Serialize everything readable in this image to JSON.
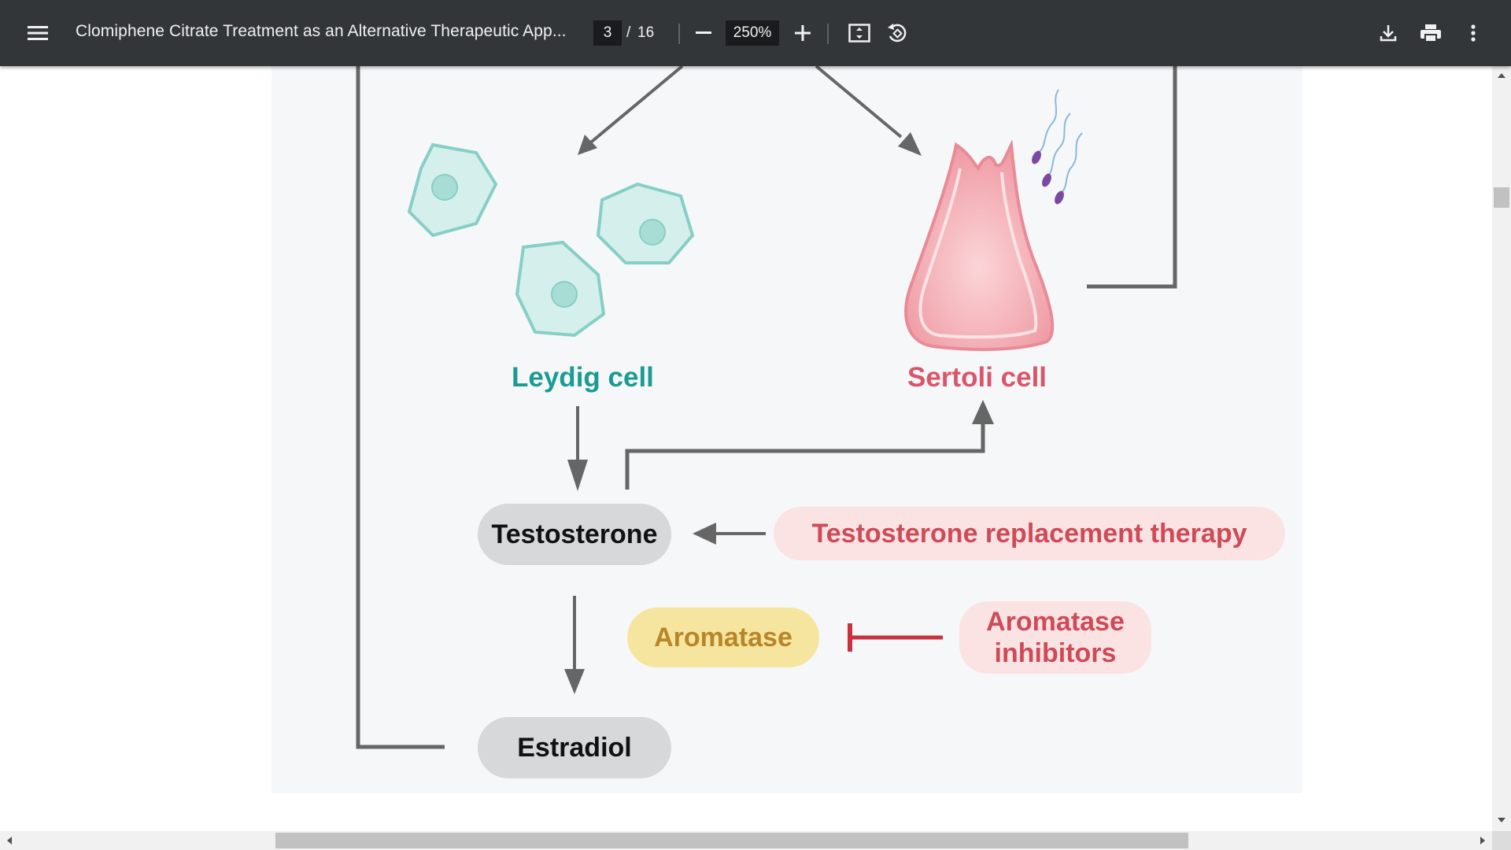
{
  "toolbar": {
    "title": "Clomiphene Citrate Treatment as an Alternative Therapeutic App...",
    "current_page": "3",
    "page_separator": "/",
    "total_pages": "16",
    "zoom": "250%"
  },
  "figure": {
    "leydig_label": "Leydig cell",
    "sertoli_label": "Sertoli cell",
    "testosterone": "Testosterone",
    "trt": "Testosterone replacement therapy",
    "aromatase": "Aromatase",
    "aromatase_inhibitors_line1": "Aromatase",
    "aromatase_inhibitors_line2": "inhibitors",
    "estradiol": "Estradiol"
  },
  "colors": {
    "toolbar_bg": "#323639",
    "leydig": "#1a9b93",
    "sertoli": "#d9566a",
    "inhibit_red": "#c8323a",
    "arrow_gray": "#666666"
  }
}
